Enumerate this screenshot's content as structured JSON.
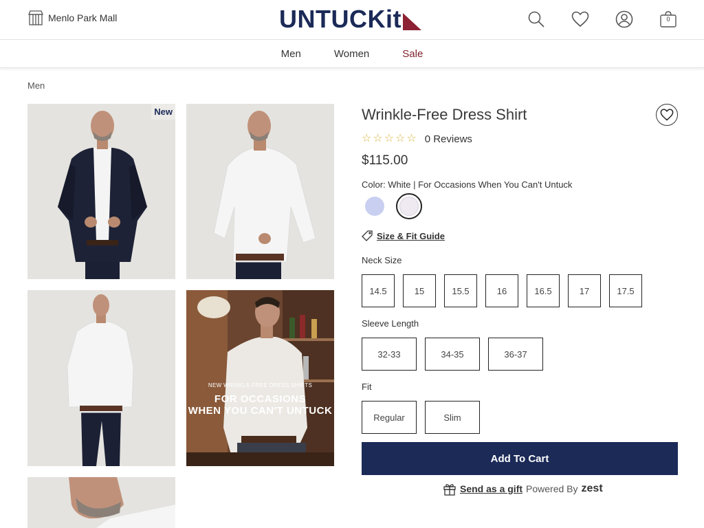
{
  "header": {
    "store_name": "Menlo Park Mall",
    "logo_text": "UNTUCKit",
    "bag_count": "0",
    "icons": [
      "store-icon",
      "search-icon",
      "heart-icon",
      "account-icon",
      "bag-icon"
    ]
  },
  "nav": {
    "items": [
      {
        "label": "Men"
      },
      {
        "label": "Women"
      },
      {
        "label": "Sale"
      }
    ],
    "sale_color": "#7d1f2a"
  },
  "breadcrumb": "Men",
  "gallery": {
    "new_badge": "New",
    "promo_small": "NEW WRINKLE-FREE DRESS SHIRTS",
    "promo_big_line1": "FOR OCCASIONS",
    "promo_big_line2": "WHEN YOU CAN'T UNTUCK"
  },
  "product": {
    "title": "Wrinkle-Free Dress Shirt",
    "rating_stars": 0,
    "rating_max": 5,
    "reviews_label": "0 Reviews",
    "price": "$115.00",
    "color_label": "Color: White | For Occasions When You Can't Untuck",
    "swatches": [
      {
        "name": "light-blue",
        "color": "#c8cff0",
        "selected": false
      },
      {
        "name": "white",
        "color": "#efe9f2",
        "selected": true
      }
    ],
    "size_guide_label": "Size & Fit Guide",
    "neck_label": "Neck Size",
    "neck_sizes": [
      "14.5",
      "15",
      "15.5",
      "16",
      "16.5",
      "17",
      "17.5"
    ],
    "sleeve_label": "Sleeve Length",
    "sleeve_lengths": [
      "32-33",
      "34-35",
      "36-37"
    ],
    "fit_label": "Fit",
    "fits": [
      "Regular",
      "Slim"
    ],
    "add_to_cart": "Add To Cart",
    "gift_link": "Send as a gift",
    "powered_by": "Powered By",
    "zest": "zest"
  },
  "colors": {
    "brand_navy": "#1b2a57",
    "star": "#d6b23a"
  }
}
